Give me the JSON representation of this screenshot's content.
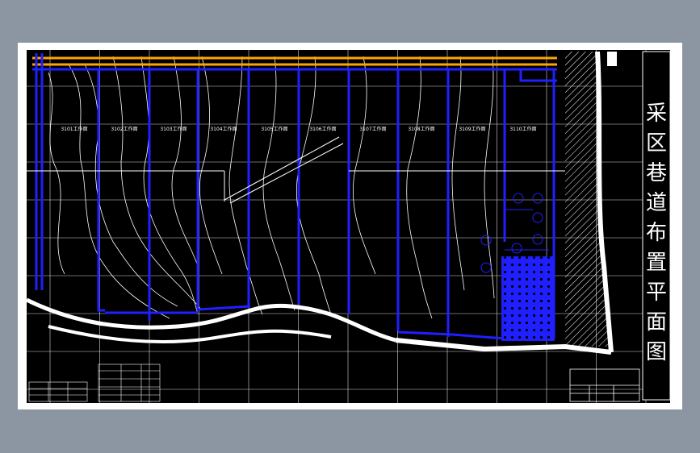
{
  "title": {
    "text": "采区巷道布置平面图",
    "chars": [
      "采",
      "区",
      "巷",
      "道",
      "布",
      "置",
      "平",
      "面",
      "图"
    ]
  },
  "panels": [
    {
      "label": "3101工作面"
    },
    {
      "label": "3102工作面"
    },
    {
      "label": "3103工作面"
    },
    {
      "label": "3104工作面"
    },
    {
      "label": "3105工作面"
    },
    {
      "label": "3106工作面"
    },
    {
      "label": "3107工作面"
    },
    {
      "label": "3108工作面"
    },
    {
      "label": "3109工作面"
    },
    {
      "label": "3110工作面"
    }
  ],
  "colors": {
    "background": "#8c96a2",
    "sheet": "#ffffff",
    "drawing": "#000000",
    "roadway": "#1f1fff",
    "main_haulage": "#ffa500",
    "grid": "#ffffff",
    "contour": "#ffffff",
    "boundary": "#ffffff"
  }
}
